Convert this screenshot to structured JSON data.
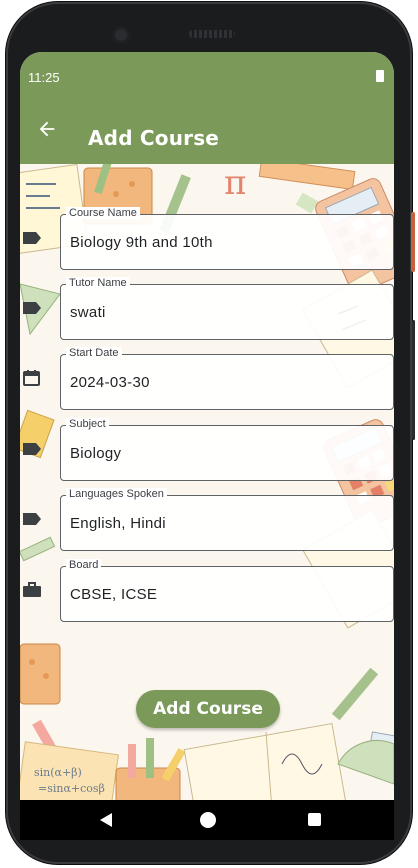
{
  "status_bar": {
    "time": "11:25"
  },
  "app_bar": {
    "title": "Add Course",
    "back_icon": "arrow-left-icon"
  },
  "fields": [
    {
      "label": "Course Name",
      "value": "Biology 9th and 10th",
      "icon": "label-tag-icon"
    },
    {
      "label": "Tutor Name",
      "value": "swati",
      "icon": "label-tag-icon"
    },
    {
      "label": "Start Date",
      "value": "2024-03-30",
      "icon": "calendar-icon"
    },
    {
      "label": "Subject",
      "value": "Biology",
      "icon": "label-tag-icon"
    },
    {
      "label": "Languages Spoken",
      "value": "English, Hindi",
      "icon": "label-tag-icon"
    },
    {
      "label": "Board",
      "value": "CBSE, ICSE",
      "icon": "briefcase-icon"
    }
  ],
  "submit_button": {
    "label": "Add Course"
  },
  "colors": {
    "primary": "#7b9a59",
    "background": "#fbf6ee",
    "outline": "#5f6366"
  }
}
